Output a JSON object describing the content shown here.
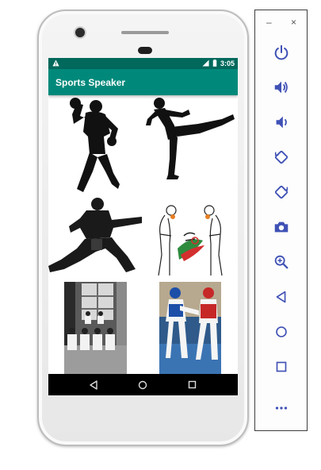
{
  "status_bar": {
    "time": "3:05",
    "warning_icon": "warning-icon",
    "signal_icon": "signal-icon",
    "battery_icon": "battery-icon"
  },
  "app_bar": {
    "title": "Sports Speaker"
  },
  "grid": {
    "tiles": [
      {
        "name": "boxing-silhouette"
      },
      {
        "name": "high-kick-silhouette"
      },
      {
        "name": "karate-punch-silhouette"
      },
      {
        "name": "bowing-fighters-drawing"
      },
      {
        "name": "dojo-bw-photo"
      },
      {
        "name": "taekwondo-match-photo"
      }
    ]
  },
  "nav_bar": {
    "back_icon": "back-icon",
    "home_icon": "home-icon",
    "recents_icon": "recents-icon"
  },
  "toolbar": {
    "minimize_label": "–",
    "close_label": "×",
    "buttons": [
      "power-icon",
      "volume-up-icon",
      "volume-down-icon",
      "rotate-left-icon",
      "rotate-right-icon",
      "camera-icon",
      "zoom-icon",
      "back-icon",
      "home-icon",
      "overview-icon",
      "more-icon"
    ],
    "accent": "#3f51b5"
  },
  "colors": {
    "status_bar": "#00695c",
    "app_bar": "#00897b"
  }
}
